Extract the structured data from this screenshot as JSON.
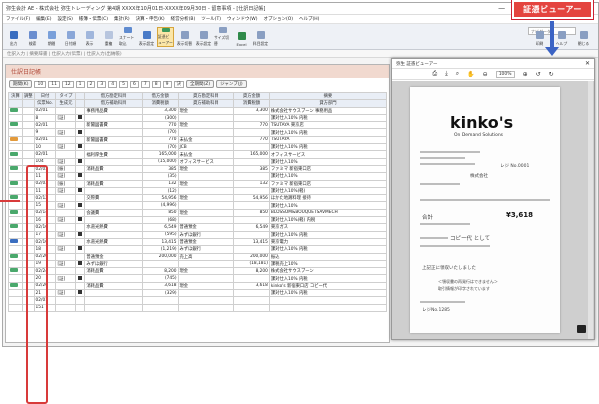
{
  "window": {
    "title": "弥生会計 AE - 株式会社 弥生トレーディング 第4期 XXXX年10月01日-XXXX年09月30日 - 留意事項 - [仕訳日記帳]"
  },
  "menu": [
    "ファイル(F)",
    "編集(E)",
    "設定(S)",
    "帳簿・伝票(C)",
    "集計(R)",
    "決算・申告(K)",
    "経営分析(B)",
    "ツール(T)",
    "ウィンドウ(W)",
    "オプション(O)",
    "ヘルプ(H)"
  ],
  "search_placeholder": "ナビゲータ",
  "toolbar": [
    {
      "label": "出力",
      "color": "#3a6ec0",
      "selected": false
    },
    {
      "label": "検索",
      "color": "#6b8ecf",
      "selected": false
    },
    {
      "label": "期間",
      "color": "#7aa0da",
      "selected": false
    },
    {
      "label": "日付順",
      "color": "#8aa7d8",
      "selected": false
    },
    {
      "label": "表示",
      "color": "#a0b6dc",
      "selected": false
    },
    {
      "label": "重複",
      "color": "#b7c5de",
      "selected": false
    },
    {
      "label": "スナート取込",
      "color": "#5f8bd0",
      "selected": false
    },
    {
      "label": "表示設定",
      "color": "#4a7bc8",
      "selected": false
    },
    {
      "label": "証憑ビューアー",
      "color": "#3b9a5a",
      "selected": true
    },
    {
      "label": "表示切替",
      "color": "#8a9fc2",
      "selected": false
    },
    {
      "label": "表示設定",
      "color": "#8a9fc2",
      "selected": false
    },
    {
      "label": "サイズ切替",
      "color": "#8a9fc2",
      "selected": false
    },
    {
      "label": "Excel",
      "color": "#2f8a4a",
      "selected": false
    },
    {
      "label": "科目設定",
      "color": "#8a9fc2",
      "selected": false
    }
  ],
  "toolbar_right": [
    "印刷",
    "ヘルプ",
    "閉じる"
  ],
  "subbar_text": "仕訳入力 | 摘要辞書 | 仕訳入力(伝票) | 仕訳入力(出納帳)",
  "sheet": {
    "title": "仕訳日記帳",
    "period_label": "期間(K)",
    "months": [
      "10",
      "11",
      "12",
      "1",
      "2",
      "3",
      "4",
      "5",
      "6",
      "7",
      "8",
      "9",
      "決"
    ],
    "all_period_button": "全期間(Z)",
    "jump_button": "ジャンプ(J)"
  },
  "table": {
    "headers1": [
      "決算",
      "調整",
      "日付",
      "タイプ",
      "",
      "借方勘定科目",
      "借方金額",
      "貸方勘定科目",
      "貸方金額",
      "摘要"
    ],
    "headers2": [
      "",
      "",
      "伝票No.",
      "生成元",
      "",
      "借方補助科目",
      "消費税額",
      "貸方補助科目",
      "消費税額",
      "貸方部門"
    ],
    "rows": [
      {
        "tag": "g",
        "date": "02/01",
        "type": "",
        "debit": "事務用品費",
        "damt": "3,300",
        "credit": "現金",
        "camt": "3,300",
        "memo": "株式会社サウスブーン 事務用品"
      },
      {
        "tag": "",
        "date": "8",
        "type": "[証]",
        "debit": "",
        "damt": "(300)",
        "credit": "",
        "camt": "",
        "memo": "課対仕入10%  内税"
      },
      {
        "tag": "g",
        "date": "02/01",
        "type": "",
        "debit": "新聞図書費",
        "damt": "770",
        "credit": "現金",
        "camt": "770",
        "memo": "TSUTAYA 東京店"
      },
      {
        "tag": "",
        "date": "9",
        "type": "[証]",
        "debit": "",
        "damt": "(70)",
        "credit": "",
        "camt": "",
        "memo": "課対仕入10%  内税"
      },
      {
        "tag": "o",
        "date": "02/01",
        "type": "",
        "debit": "新聞図書費",
        "damt": "770",
        "credit": "未払金",
        "camt": "770",
        "memo": "TSUTAYA"
      },
      {
        "tag": "",
        "date": "10",
        "type": "[証]",
        "debit": "",
        "damt": "(70)",
        "credit": "JCB",
        "camt": "",
        "memo": "課対仕入10%  内税"
      },
      {
        "tag": "g",
        "date": "02/01",
        "type": "",
        "debit": "福利厚生費",
        "damt": "165,000",
        "credit": "未払金",
        "camt": "165,000",
        "memo": "オフィスサービス"
      },
      {
        "tag": "",
        "date": "104",
        "type": "[証]",
        "debit": "",
        "damt": "(15,000)",
        "credit": "オフィスサービス",
        "camt": "",
        "memo": "課対仕入10%"
      },
      {
        "tag": "g",
        "date": "02/03",
        "type": "[振]",
        "debit": "消耗品費",
        "damt": "385",
        "credit": "現金",
        "camt": "385",
        "memo": "ファミマ 新宿東口店"
      },
      {
        "tag": "",
        "date": "11",
        "type": "[証]",
        "debit": "",
        "damt": "(35)",
        "credit": "",
        "camt": "",
        "memo": "課対仕入10%"
      },
      {
        "tag": "g",
        "date": "02/03",
        "type": "[振]",
        "debit": "消耗品費",
        "damt": "132",
        "credit": "現金",
        "camt": "132",
        "memo": "ファミマ 新宿東口店"
      },
      {
        "tag": "",
        "date": "11",
        "type": "[証]",
        "debit": "",
        "damt": "(12)",
        "credit": "",
        "camt": "",
        "memo": "課対仕入10%(軽)"
      },
      {
        "tag": "g",
        "date": "02/12",
        "type": "",
        "debit": "交際費",
        "damt": "54,956",
        "credit": "現金",
        "camt": "54,956",
        "memo": "ほかた地鶏料理 接待"
      },
      {
        "tag": "",
        "date": "15",
        "type": "[証]",
        "debit": "",
        "damt": "(4,996)",
        "credit": "",
        "camt": "",
        "memo": "課対仕入10%"
      },
      {
        "tag": "g",
        "date": "02/14",
        "type": "",
        "debit": "会議費",
        "damt": "850",
        "credit": "現金",
        "camt": "850",
        "memo": "BLOSSOM&BOUQUETSAVMECH"
      },
      {
        "tag": "",
        "date": "16",
        "type": "[証]",
        "debit": "",
        "damt": "(68)",
        "credit": "",
        "camt": "",
        "memo": "課対仕入10%(軽)  内税"
      },
      {
        "tag": "g",
        "date": "02/16",
        "type": "",
        "debit": "水道光熱費",
        "damt": "6,549",
        "credit": "普通預金",
        "camt": "6,549",
        "memo": "東京ガス"
      },
      {
        "tag": "",
        "date": "17",
        "type": "[証]",
        "debit": "",
        "damt": "(595)",
        "credit": "みずほ銀行",
        "camt": "",
        "memo": "課対仕入10%  内税"
      },
      {
        "tag": "b",
        "date": "02/16",
        "type": "",
        "debit": "水道光熱費",
        "damt": "13,415",
        "credit": "普通預金",
        "camt": "13,415",
        "memo": "東京電力"
      },
      {
        "tag": "",
        "date": "18",
        "type": "[証]",
        "debit": "",
        "damt": "(1,219)",
        "credit": "みずほ銀行",
        "camt": "",
        "memo": "課対仕入10%  内税"
      },
      {
        "tag": "g",
        "date": "02/20",
        "type": "",
        "debit": "普通預金",
        "damt": "200,000",
        "credit": "売上高",
        "camt": "200,000",
        "memo": "振込"
      },
      {
        "tag": "",
        "date": "19",
        "type": "[証]",
        "debit": "みずほ銀行",
        "damt": "",
        "credit": "",
        "camt": "(18,181)",
        "memo": "課税売上10%"
      },
      {
        "tag": "g",
        "date": "02/24",
        "type": "",
        "debit": "消耗品費",
        "damt": "8,200",
        "credit": "現金",
        "camt": "8,200",
        "memo": "株式会社サウスブーン"
      },
      {
        "tag": "",
        "date": "20",
        "type": "[証]",
        "debit": "",
        "damt": "(745)",
        "credit": "",
        "camt": "",
        "memo": "課対仕入10%  内税"
      },
      {
        "tag": "g",
        "date": "02/26",
        "type": "",
        "debit": "消耗品費",
        "damt": "3,618",
        "credit": "現金",
        "camt": "3,618",
        "memo": "kinko's 新宿東口店 コピー代"
      },
      {
        "tag": "",
        "date": "21",
        "type": "[証]",
        "debit": "",
        "damt": "(329)",
        "credit": "",
        "camt": "",
        "memo": "課対仕入10%  内税"
      },
      {
        "tag": "",
        "date": "02/01",
        "type": "",
        "debit": "",
        "damt": "",
        "credit": "",
        "camt": "",
        "memo": ""
      },
      {
        "tag": "",
        "date": "151",
        "type": "",
        "debit": "",
        "damt": "",
        "credit": "",
        "camt": "",
        "memo": ""
      }
    ]
  },
  "callout_label": "証憑ビューアー",
  "viewer": {
    "title": "弥生 証憑ビューアー",
    "zoom": "100%",
    "receipt": {
      "brand": "kinko's",
      "brand_sub": "On Demand Solutions",
      "reg_label": "レジ No.0001",
      "store_label": "株式会社",
      "total_label": "合計",
      "total_value": "¥3,618",
      "note": "コピー代 として",
      "thanks": "上記正に領収いたしました",
      "footer1": "＜領収書の再発行はできません＞",
      "footer2": "取引情報が印字されています",
      "reg_footer": "レジNo.1285"
    }
  }
}
